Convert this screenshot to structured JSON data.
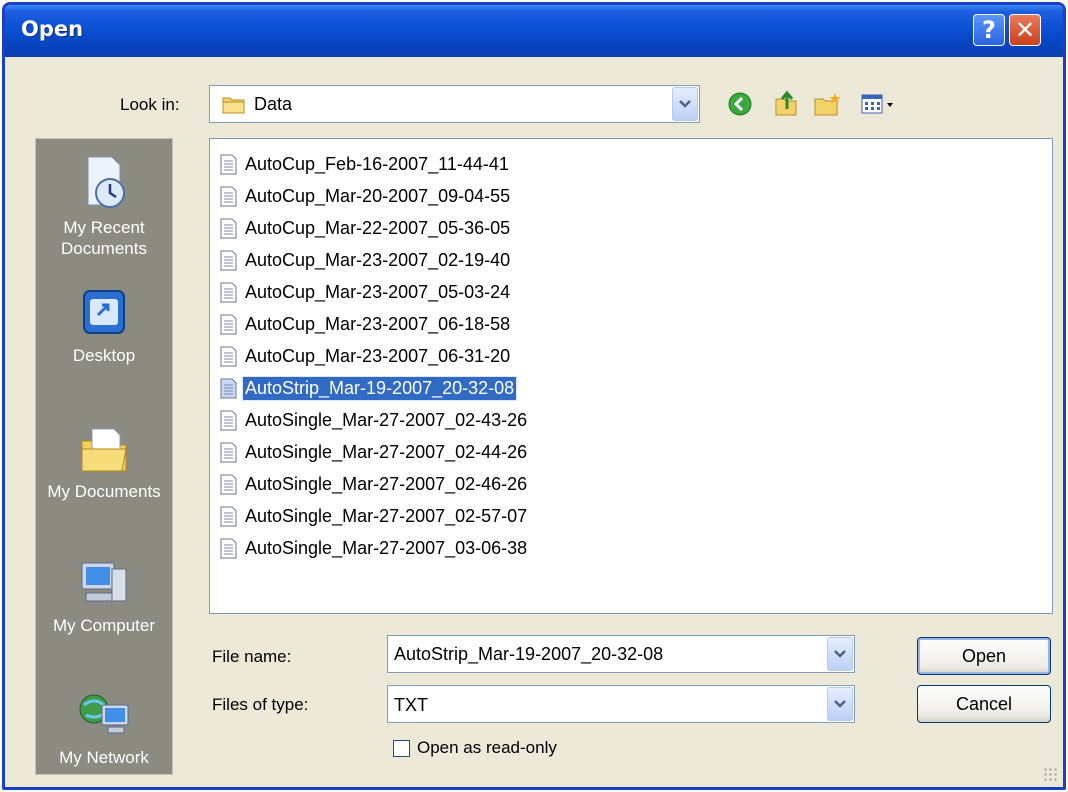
{
  "window": {
    "title": "Open"
  },
  "titlebar_buttons": {
    "help": "?",
    "close": "✕"
  },
  "look_in": {
    "label": "Look in:",
    "value": "Data"
  },
  "toolbar": {
    "icons": [
      "back-arrow-icon",
      "up-folder-icon",
      "new-folder-icon",
      "views-menu-icon"
    ]
  },
  "places": [
    {
      "label": "My Recent Documents",
      "icon": "recent-documents-icon"
    },
    {
      "label": "Desktop",
      "icon": "desktop-icon"
    },
    {
      "label": "My Documents",
      "icon": "my-documents-icon"
    },
    {
      "label": "My Computer",
      "icon": "my-computer-icon"
    },
    {
      "label": "My Network",
      "icon": "my-network-icon"
    }
  ],
  "files": [
    "AutoCup_Feb-16-2007_11-44-41",
    "AutoCup_Mar-20-2007_09-04-55",
    "AutoCup_Mar-22-2007_05-36-05",
    "AutoCup_Mar-23-2007_02-19-40",
    "AutoCup_Mar-23-2007_05-03-24",
    "AutoCup_Mar-23-2007_06-18-58",
    "AutoCup_Mar-23-2007_06-31-20",
    "AutoStrip_Mar-19-2007_20-32-08",
    "AutoSingle_Mar-27-2007_02-43-26",
    "AutoSingle_Mar-27-2007_02-44-26",
    "AutoSingle_Mar-27-2007_02-46-26",
    "AutoSingle_Mar-27-2007_02-57-07",
    "AutoSingle_Mar-27-2007_03-06-38"
  ],
  "selected_index": 7,
  "file_name": {
    "label": "File name:",
    "value": "AutoStrip_Mar-19-2007_20-32-08"
  },
  "file_type": {
    "label": "Files of type:",
    "value": "TXT"
  },
  "read_only": {
    "label": "Open as read-only",
    "checked": false
  },
  "buttons": {
    "open": "Open",
    "cancel": "Cancel"
  },
  "colors": {
    "titlebar": "#0a4fd4",
    "selection": "#316ac5",
    "places_bg": "#8b8b82",
    "dialog_bg": "#ece9d8"
  }
}
